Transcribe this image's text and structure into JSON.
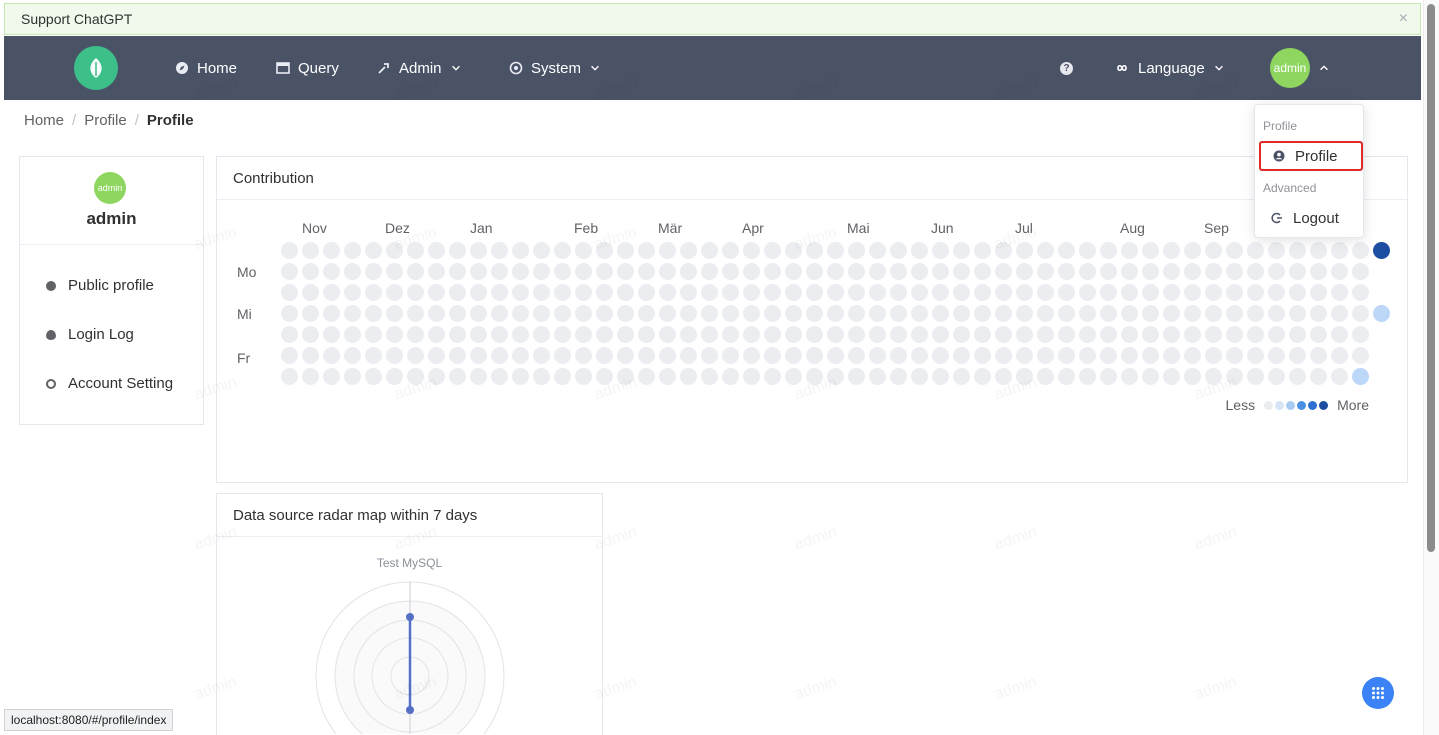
{
  "banner": {
    "text": "Support ChatGPT",
    "close": "×"
  },
  "nav": {
    "items": [
      {
        "label": "Home"
      },
      {
        "label": "Query"
      },
      {
        "label": "Admin"
      },
      {
        "label": "System"
      }
    ],
    "help_glyph": "?",
    "language_label": "Language",
    "avatar_text": "admin"
  },
  "breadcrumb": {
    "items": [
      "Home",
      "Profile",
      "Profile"
    ],
    "separator": "/"
  },
  "sidebar": {
    "avatar_text": "admin",
    "name": "admin",
    "links": [
      {
        "label": "Public profile",
        "icon": "globe-icon"
      },
      {
        "label": "Login Log",
        "icon": "log-icon"
      },
      {
        "label": "Account Setting",
        "icon": "user-setting-icon"
      }
    ]
  },
  "contribution": {
    "title": "Contribution",
    "months": [
      "Nov",
      "Dez",
      "Jan",
      "Feb",
      "Mär",
      "Apr",
      "Mai",
      "Jun",
      "Jul",
      "Aug",
      "Sep"
    ],
    "day_labels": [
      "Mo",
      "Mi",
      "Fr"
    ],
    "legend_less": "Less",
    "legend_more": "More",
    "legend_colors": [
      "#ebedf0",
      "#d6e4f5",
      "#a9cbf2",
      "#4a90e2",
      "#2e6fd1",
      "#1d4ea2"
    ],
    "highlighted": [
      {
        "week": 52,
        "day": 0,
        "color": "#1d4ea2"
      },
      {
        "week": 52,
        "day": 3,
        "color": "#bcd7f7"
      },
      {
        "week": 51,
        "day": 6,
        "color": "#bcd7f7"
      }
    ]
  },
  "radar": {
    "title": "Data source radar map within 7 days",
    "series_label": "Test MySQL",
    "accent": "#5470c6"
  },
  "user_menu": {
    "group_profile": "Profile",
    "item_profile": "Profile",
    "group_advanced": "Advanced",
    "item_logout": "Logout"
  },
  "statusbar": {
    "url": "localhost:8080/#/profile/index"
  },
  "watermark": "admin",
  "colors": {
    "navbar": "#4a5266",
    "brand": "#3dbf8a",
    "avatar": "#8ed65f",
    "fab": "#3b82f6"
  }
}
